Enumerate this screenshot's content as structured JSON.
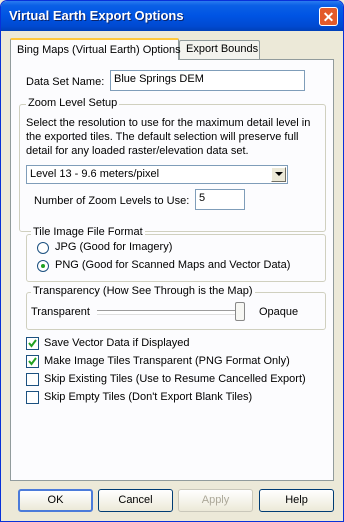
{
  "window": {
    "title": "Virtual Earth Export Options",
    "close_glyph": "✕"
  },
  "tabs": [
    {
      "label": "Bing Maps (Virtual Earth) Options",
      "active": true
    },
    {
      "label": "Export Bounds",
      "active": false
    }
  ],
  "dataset": {
    "label": "Data Set Name:",
    "value": "Blue Springs DEM"
  },
  "zoom": {
    "group_title": "Zoom Level Setup",
    "description": "Select the resolution to use for the maximum detail level in the exported tiles. The default selection will preserve full detail for any loaded raster/elevation data set.",
    "resolution_selected": "Level 13 - 9.6 meters/pixel",
    "levels_label": "Number of Zoom Levels to Use:",
    "levels_value": "5"
  },
  "format": {
    "group_title": "Tile Image File Format",
    "options": [
      {
        "label": "JPG (Good for Imagery)",
        "selected": false
      },
      {
        "label": "PNG (Good for Scanned Maps and Vector Data)",
        "selected": true
      }
    ]
  },
  "transparency": {
    "group_title": "Transparency (How See Through is the Map)",
    "left_label": "Transparent",
    "right_label": "Opaque",
    "level_percent": 100
  },
  "checkboxes": [
    {
      "label": "Save Vector Data if Displayed",
      "checked": true
    },
    {
      "label": "Make Image Tiles Transparent (PNG Format Only)",
      "checked": true
    },
    {
      "label": "Skip Existing Tiles (Use to Resume Cancelled Export)",
      "checked": false
    },
    {
      "label": "Skip Empty Tiles (Don't Export Blank Tiles)",
      "checked": false
    }
  ],
  "buttons": {
    "ok": "OK",
    "cancel": "Cancel",
    "apply": "Apply",
    "help": "Help"
  },
  "colors": {
    "title_bar": "#0054e3",
    "window_bg": "#ece9d8",
    "close_button": "#e35a2b",
    "radio_dot": "#21a121"
  }
}
